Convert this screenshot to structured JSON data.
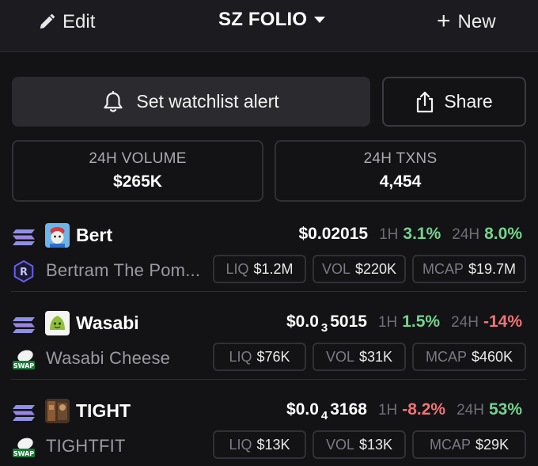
{
  "header": {
    "edit_label": "Edit",
    "title": "SZ FOLIO",
    "new_label": "New"
  },
  "actions": {
    "alert_label": "Set watchlist alert",
    "share_label": "Share"
  },
  "stats": [
    {
      "label": "24H VOLUME",
      "value": "$265K"
    },
    {
      "label": "24H TXNS",
      "value": "4,454"
    }
  ],
  "tokens": [
    {
      "symbol": "Bert",
      "name": "Bertram The Pom...",
      "price_prefix": "$0.02015",
      "price_sub": "",
      "price_rest": "",
      "h1_label": "1H",
      "h1_change": "3.1%",
      "h24_label": "24H",
      "h24_change": "8.0%",
      "liq_label": "LIQ",
      "liq": "$1.2M",
      "vol_label": "VOL",
      "vol": "$220K",
      "mcap_label": "MCAP",
      "mcap": "$19.7M",
      "h1_color": "#74d48f",
      "h24_color": "#74d48f",
      "dex_icon": "raydium-icon"
    },
    {
      "symbol": "Wasabi",
      "name": "Wasabi Cheese",
      "price_prefix": "$0.0",
      "price_sub": "3",
      "price_rest": "5015",
      "h1_label": "1H",
      "h1_change": "1.5%",
      "h24_label": "24H",
      "h24_change": "-14%",
      "liq_label": "LIQ",
      "liq": "$76K",
      "vol_label": "VOL",
      "vol": "$31K",
      "mcap_label": "MCAP",
      "mcap": "$460K",
      "h1_color": "#74d48f",
      "h24_color": "#f07474",
      "dex_icon": "swap-icon",
      "dex_badge": "SWAP"
    },
    {
      "symbol": "TIGHT",
      "name": "TIGHTFIT",
      "price_prefix": "$0.0",
      "price_sub": "4",
      "price_rest": "3168",
      "h1_label": "1H",
      "h1_change": "-8.2%",
      "h24_label": "24H",
      "h24_change": "53%",
      "liq_label": "LIQ",
      "liq": "$13K",
      "vol_label": "VOL",
      "vol": "$13K",
      "mcap_label": "MCAP",
      "mcap": "$29K",
      "h1_color": "#f07474",
      "h24_color": "#74d48f",
      "dex_icon": "swap-icon",
      "dex_badge": "SWAP"
    }
  ]
}
